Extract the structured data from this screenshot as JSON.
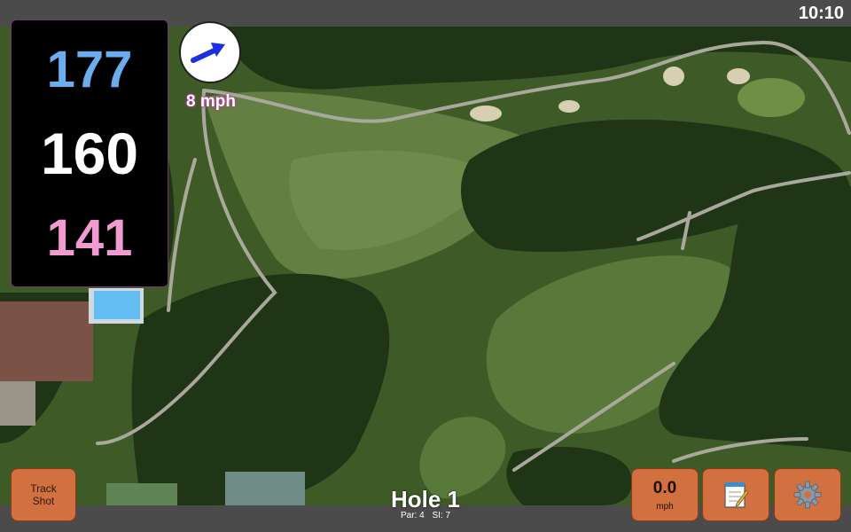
{
  "status": {
    "time": "10:10"
  },
  "distances": {
    "back": "177",
    "middle": "160",
    "front": "141"
  },
  "wind": {
    "speed": "8 mph",
    "icon": "wind-arrow-icon"
  },
  "hole": {
    "title": "Hole 1",
    "par": "Par: 4",
    "si": "SI: 7"
  },
  "buttons": {
    "track_shot_line1": "Track",
    "track_shot_line2": "Shot",
    "speed_value": "0.0",
    "speed_unit": "mph",
    "notes_icon": "notepad-icon",
    "settings_icon": "gear-icon"
  },
  "colors": {
    "back": "#6aaef0",
    "middle": "#ffffff",
    "front": "#f29bd0",
    "button": "#d2703f",
    "accent": "#c22fa0"
  }
}
